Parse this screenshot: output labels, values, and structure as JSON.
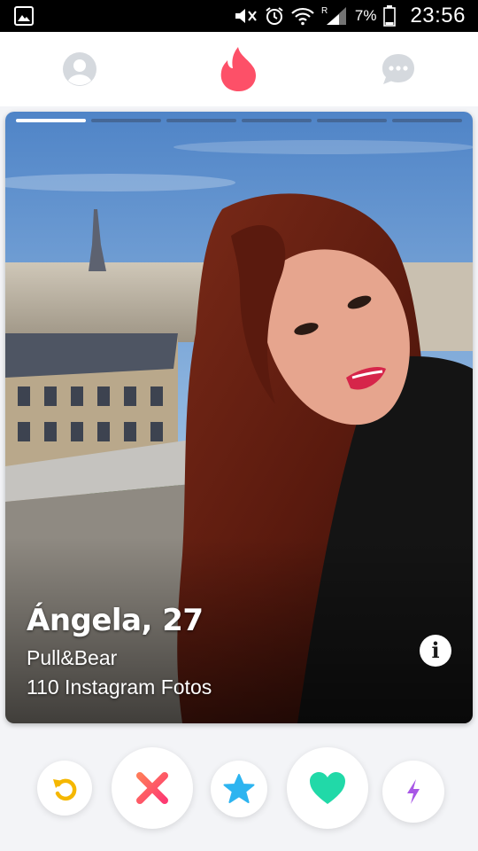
{
  "status_bar": {
    "battery_percent": "7%",
    "time": "23:56",
    "network_label": "R"
  },
  "top_nav": {
    "icons": [
      "profile-icon",
      "flame-logo-icon",
      "chat-icon"
    ],
    "active": "flame-logo-icon"
  },
  "card": {
    "name_age": "Ángela, 27",
    "line1": "Pull&Bear",
    "line2": "110 Instagram Fotos",
    "photo_count": 6,
    "active_photo": 1,
    "info_label": "i"
  },
  "actions": {
    "icons": [
      "rewind-icon",
      "nope-x-icon",
      "super-like-star-icon",
      "like-heart-icon",
      "boost-bolt-icon"
    ]
  },
  "colors": {
    "brand_flame": "#fd5068",
    "nope": "#fd5068",
    "rewind": "#f5b700",
    "superlike": "#2db4f0",
    "like": "#21d9a8",
    "boost": "#a857e6",
    "nav_inactive": "#d5d9de"
  }
}
